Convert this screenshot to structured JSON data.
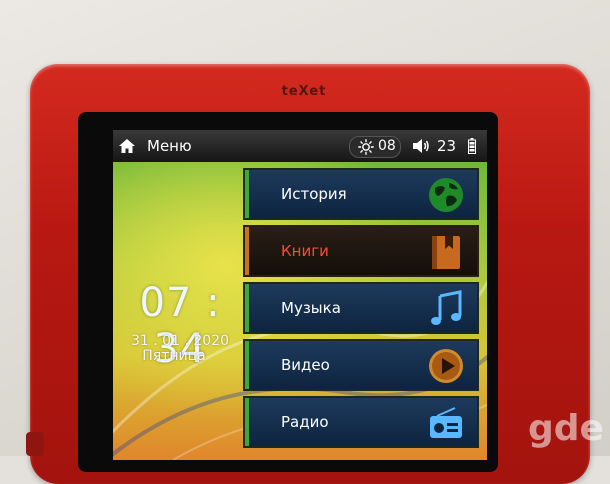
{
  "device": {
    "brand": "teXet"
  },
  "statusbar": {
    "title": "Меню",
    "brightness": "08",
    "volume": "23",
    "icons": {
      "home": "home-icon",
      "brightness": "sun-icon",
      "volume": "speaker-icon",
      "battery": "battery-icon"
    }
  },
  "clock": {
    "time": "07 : 34",
    "date": "31 . 01 . 2020",
    "weekday": "Пятница"
  },
  "menu": {
    "items": [
      {
        "label": "История",
        "icon": "globe-icon"
      },
      {
        "label": "Книги",
        "icon": "book-icon",
        "selected": true
      },
      {
        "label": "Музыка",
        "icon": "music-note-icon"
      },
      {
        "label": "Видео",
        "icon": "play-icon"
      },
      {
        "label": "Радио",
        "icon": "radio-icon"
      }
    ]
  },
  "watermark": "gde",
  "colors": {
    "case": "#c41e16",
    "accent_selected": "#ff4a2a",
    "item_bg": "#1e3a5c"
  }
}
